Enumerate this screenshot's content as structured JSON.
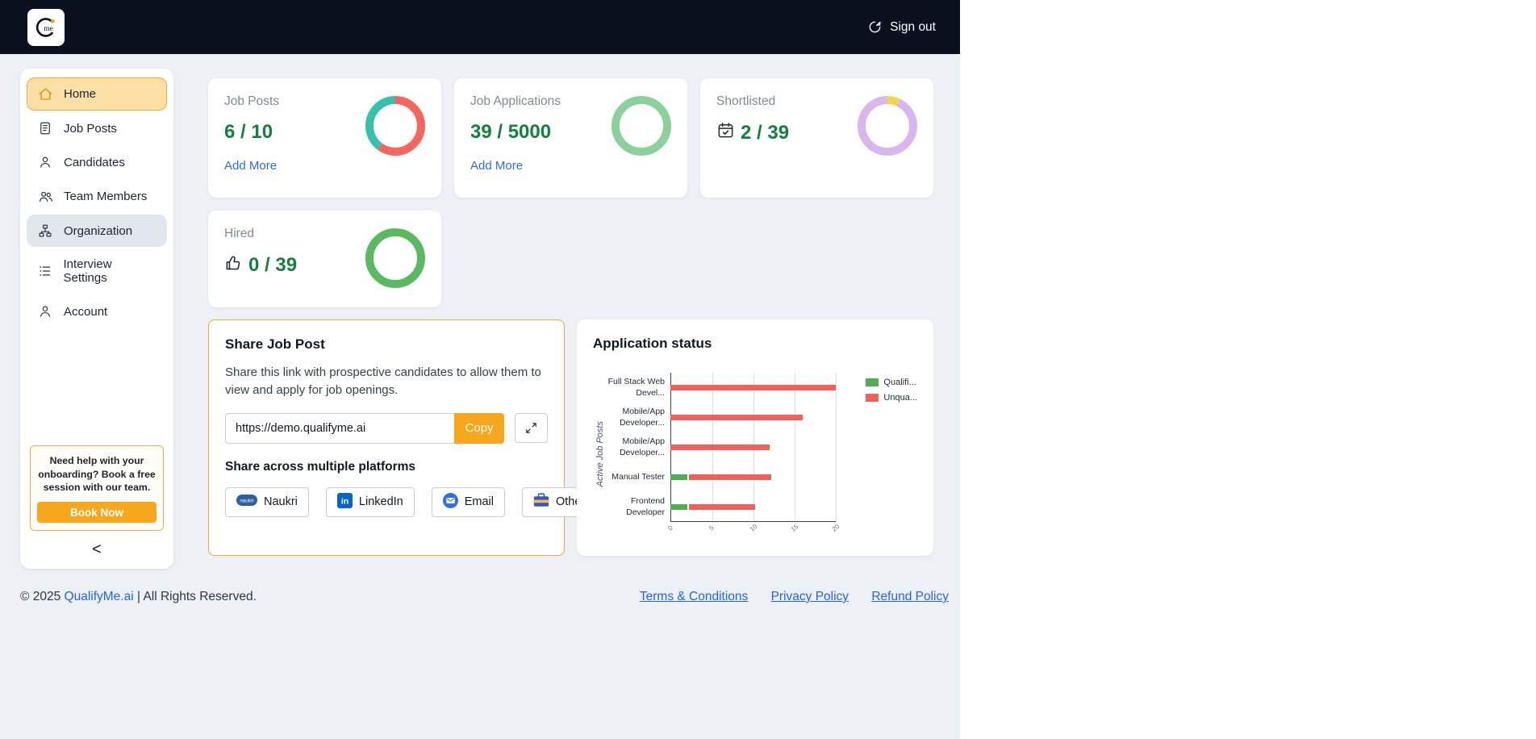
{
  "header": {
    "sign_out_label": "Sign out"
  },
  "sidebar": {
    "items": [
      {
        "label": "Home"
      },
      {
        "label": "Job Posts"
      },
      {
        "label": "Candidates"
      },
      {
        "label": "Team Members"
      },
      {
        "label": "Organization"
      },
      {
        "label": "Interview Settings"
      },
      {
        "label": "Account"
      }
    ],
    "help": {
      "text": "Need help with your onboarding? Book a free session with our team.",
      "button_label": "Book Now"
    },
    "collapse_label": "<"
  },
  "stats": [
    {
      "title": "Job Posts",
      "value": "6 / 10",
      "link_label": "Add More",
      "donut": {
        "segments": [
          {
            "color": "#f4665e",
            "frac": 0.6
          },
          {
            "color": "#38c0af",
            "frac": 0.4
          }
        ]
      }
    },
    {
      "title": "Job Applications",
      "value": "39 / 5000",
      "link_label": "Add More",
      "donut": {
        "segments": [
          {
            "color": "#8bd19c",
            "frac": 1
          }
        ]
      }
    },
    {
      "title": "Shortlisted",
      "value": "2 / 39",
      "icon": "calendar-check-icon",
      "donut": {
        "segments": [
          {
            "color": "#f4d44f",
            "frac": 0.07
          },
          {
            "color": "#d9b6ee",
            "frac": 0.93
          }
        ]
      }
    },
    {
      "title": "Hired",
      "value": "0 / 39",
      "icon": "thumbs-up-icon",
      "donut": {
        "segments": [
          {
            "color": "#5aba61",
            "frac": 1
          }
        ]
      }
    }
  ],
  "share": {
    "title": "Share Job Post",
    "description": "Share this link with prospective candidates to allow them to view and apply for job openings.",
    "url": "https://demo.qualifyme.ai",
    "copy_label": "Copy",
    "platforms_title": "Share across multiple platforms",
    "platforms": [
      {
        "label": "Naukri",
        "icon": "naukri-icon"
      },
      {
        "label": "LinkedIn",
        "icon": "linkedin-icon"
      },
      {
        "label": "Email",
        "icon": "email-icon"
      },
      {
        "label": "Others",
        "icon": "briefcase-icon"
      }
    ]
  },
  "application_status": {
    "title": "Application status",
    "chart_data": {
      "type": "bar",
      "orientation": "horizontal",
      "categories": [
        "Full Stack Web Devel...",
        "Mobile/App Developer...",
        "Mobile/App Developer...",
        "Manual Tester",
        "Frontend Developer"
      ],
      "series": [
        {
          "name": "Qualified",
          "legend_label": "Qualifi...",
          "color": "#4caf50",
          "values": [
            0,
            0,
            0,
            2,
            2
          ]
        },
        {
          "name": "Unqualified",
          "legend_label": "Unqua...",
          "color": "#f2605a",
          "values": [
            20,
            16,
            12,
            10,
            8
          ]
        }
      ],
      "ylabel": "Active Job Posts",
      "xlabel": "",
      "xlim": [
        0,
        20
      ],
      "xticks": [
        0,
        5,
        10,
        15,
        20
      ],
      "grid": true,
      "legend_position": "top-right"
    }
  },
  "footer": {
    "copyright_prefix": "© 2025 ",
    "brand_link": "QualifyMe.ai",
    "copyright_suffix": " | All Rights Reserved.",
    "links": [
      {
        "label": "Terms & Conditions"
      },
      {
        "label": "Privacy Policy"
      },
      {
        "label": "Refund Policy"
      }
    ]
  },
  "colors": {
    "accent_orange": "#f6a71b",
    "header_bg": "#0b101e",
    "page_bg": "#edf0f4",
    "link_blue": "#2563eb",
    "value_green": "#15803d"
  }
}
